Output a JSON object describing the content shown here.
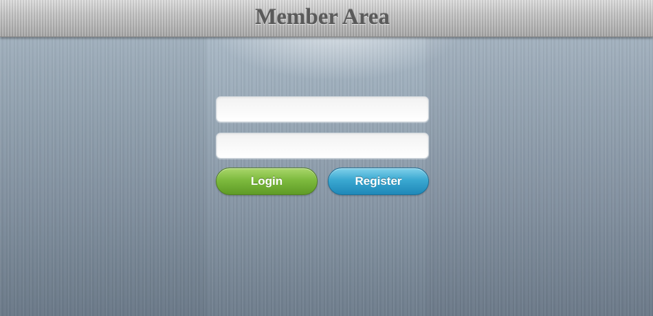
{
  "header": {
    "title": "Member Area"
  },
  "login_form": {
    "username_value": "",
    "password_value": "",
    "login_label": "Login",
    "register_label": "Register"
  },
  "colors": {
    "login_button": "#7dba3e",
    "register_button": "#3aa8d1",
    "header_text": "#5a5a5a",
    "background": "#8d9cab"
  }
}
